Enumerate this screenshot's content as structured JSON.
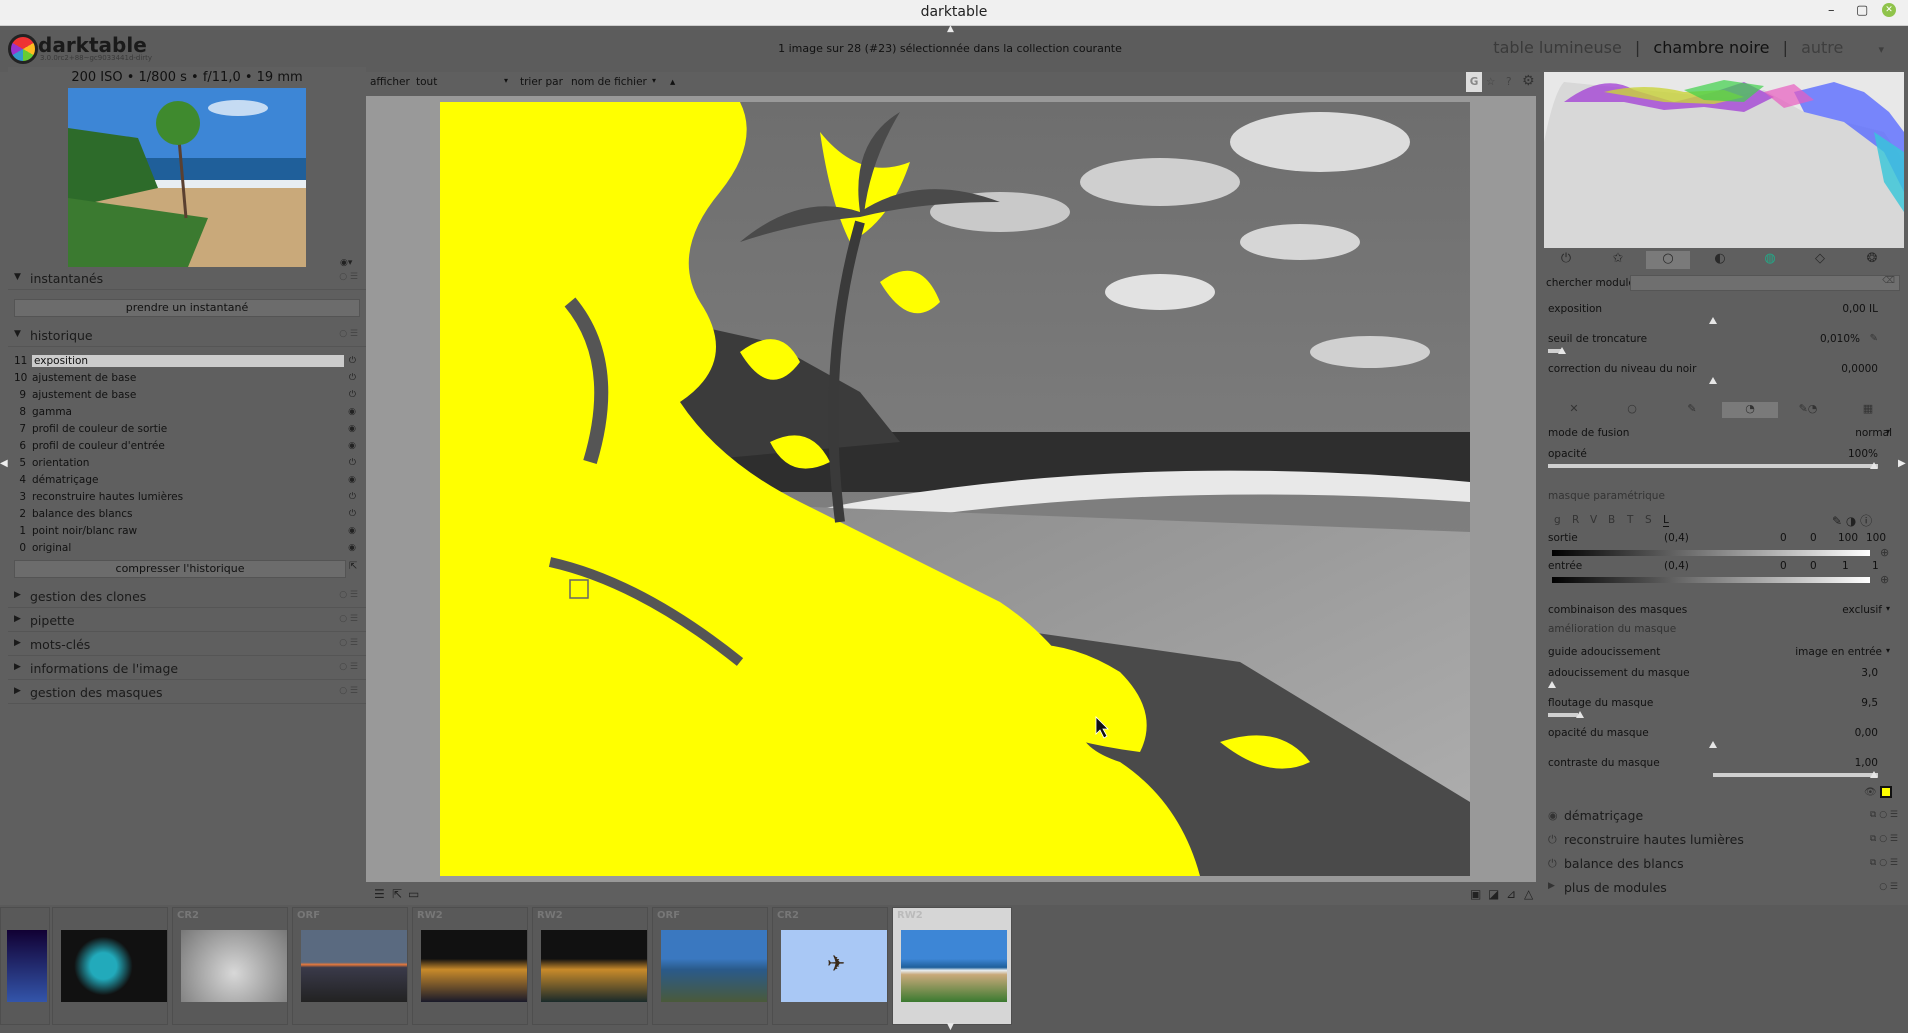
{
  "window": {
    "title": "darktable",
    "buttons": [
      "–",
      "▢",
      "✕"
    ]
  },
  "app": {
    "logo_name": "darktable",
    "version": "3.0.0rc2+88~gc9033441d-dirty"
  },
  "header": {
    "selection_info": "1 image sur 28 (#23) sélectionnée dans la collection courante",
    "views": {
      "lighttable": "table lumineuse",
      "sep1": "|",
      "darkroom": "chambre noire",
      "sep2": "|",
      "other": "autre",
      "menu": "▾"
    }
  },
  "left": {
    "exif": "200 ISO • 1/800 s • f/11,0 • 19 mm",
    "snapshots": {
      "title": "instantanés",
      "button": "prendre un instantané"
    },
    "history": {
      "title": "historique",
      "items": [
        {
          "n": "11",
          "label": "exposition"
        },
        {
          "n": "10",
          "label": "ajustement de base"
        },
        {
          "n": "9",
          "label": "ajustement de base"
        },
        {
          "n": "8",
          "label": "gamma"
        },
        {
          "n": "7",
          "label": "profil de couleur de sortie"
        },
        {
          "n": "6",
          "label": "profil de couleur d'entrée"
        },
        {
          "n": "5",
          "label": "orientation"
        },
        {
          "n": "4",
          "label": "dématriçage"
        },
        {
          "n": "3",
          "label": "reconstruire hautes lumières"
        },
        {
          "n": "2",
          "label": "balance des blancs"
        },
        {
          "n": "1",
          "label": "point noir/blanc raw"
        },
        {
          "n": "0",
          "label": "original"
        }
      ],
      "compress": "compresser l'historique"
    },
    "sections": [
      "gestion des clones",
      "pipette",
      "mots-clés",
      "informations de l'image",
      "gestion des masques"
    ]
  },
  "filterbar": {
    "show_label": "afficher",
    "show_value": "tout",
    "sort_label": "trier par",
    "sort_value": "nom de fichier",
    "arrow": "▾"
  },
  "right": {
    "search_label": "chercher module",
    "exposure": {
      "rows": [
        {
          "label": "exposition",
          "value": "0,00 IL"
        },
        {
          "label": "seuil de troncature",
          "value": "0,010%"
        },
        {
          "label": "correction du niveau du noir",
          "value": "0,0000"
        }
      ]
    },
    "blend": {
      "mode_label": "mode de fusion",
      "mode_value": "normal",
      "opacity_label": "opacité",
      "opacity_value": "100%",
      "param_mask": "masque paramétrique",
      "channels": [
        "g",
        "R",
        "V",
        "B",
        "T",
        "S",
        "L"
      ],
      "output_label": "sortie",
      "output_range": "(0,4)",
      "output_vals": [
        "0",
        "0",
        "100",
        "100"
      ],
      "input_label": "entrée",
      "input_range": "(0,4)",
      "input_vals": [
        "0",
        "0",
        "1",
        "1"
      ],
      "combine_label": "combinaison des masques",
      "combine_value": "exclusif",
      "refine": "amélioration du masque",
      "guide_label": "guide adoucissement",
      "guide_value": "image en entrée",
      "sliders": [
        {
          "label": "adoucissement du masque",
          "value": "3,0"
        },
        {
          "label": "floutage du masque",
          "value": "9,5"
        },
        {
          "label": "opacité du masque",
          "value": "0,00"
        },
        {
          "label": "contraste du masque",
          "value": "1,00"
        }
      ]
    },
    "modules": [
      "dématriçage",
      "reconstruire hautes lumières",
      "balance des blancs",
      "plus de modules"
    ]
  },
  "filmstrip": [
    {
      "ext": ""
    },
    {
      "ext": ""
    },
    {
      "ext": "CR2"
    },
    {
      "ext": "ORF"
    },
    {
      "ext": "RW2"
    },
    {
      "ext": "RW2"
    },
    {
      "ext": "ORF"
    },
    {
      "ext": "CR2"
    },
    {
      "ext": "RW2"
    }
  ]
}
